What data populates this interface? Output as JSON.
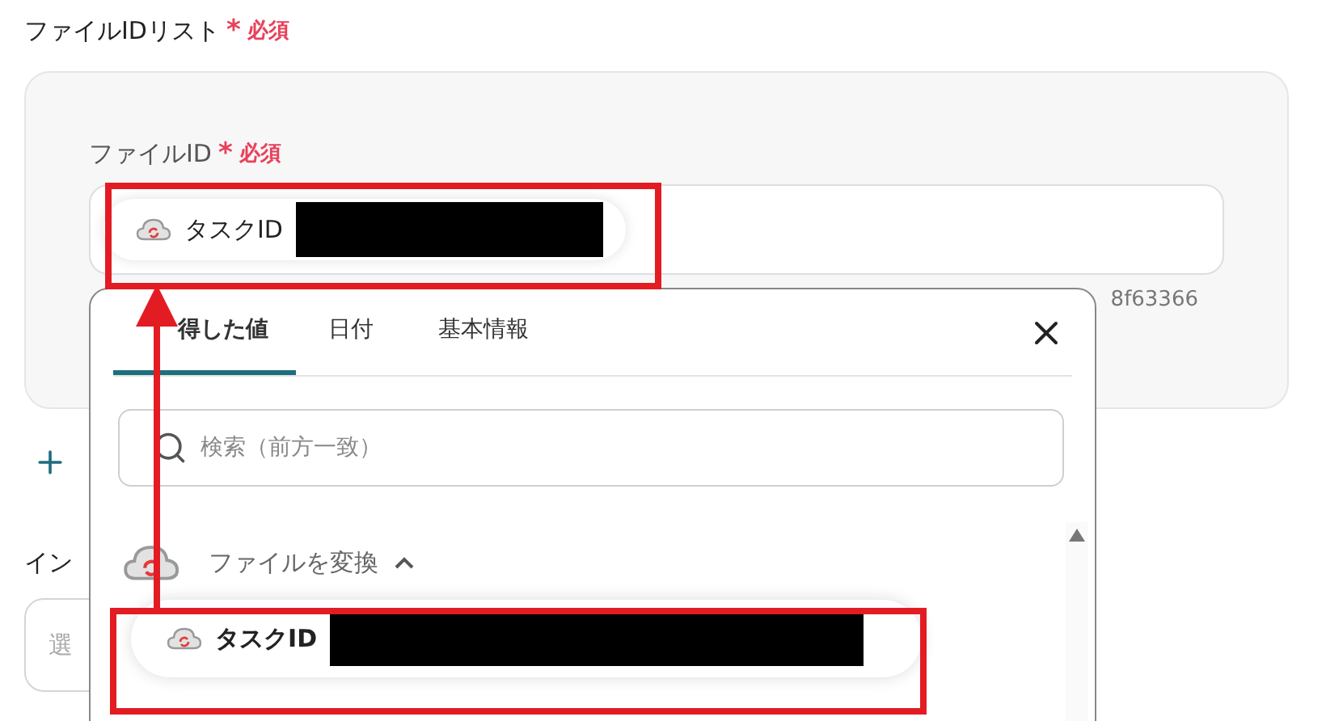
{
  "file_id_list": {
    "label": "ファイルIDリスト",
    "asterisk": "*",
    "required": "必須",
    "file_id": {
      "label": "ファイルID",
      "asterisk": "*",
      "required": "必須",
      "chip": {
        "label": "タスクID"
      },
      "hint": "8f63366"
    }
  },
  "next_field": {
    "label": "イン",
    "placeholder": "選"
  },
  "popup": {
    "tabs": [
      {
        "label": "得した値",
        "selected": true
      },
      {
        "label": "日付",
        "selected": false
      },
      {
        "label": "基本情報",
        "selected": false
      }
    ],
    "search": {
      "placeholder": "検索（前方一致）"
    },
    "groups": [
      {
        "title": "ファイルを変換",
        "expanded": true,
        "items": [
          {
            "label": "タスクID"
          }
        ]
      }
    ]
  }
}
